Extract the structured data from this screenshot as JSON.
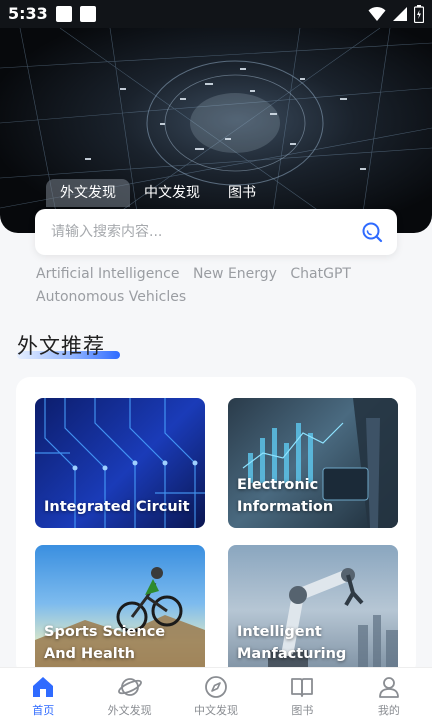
{
  "status_bar": {
    "time": "5:33"
  },
  "tabs": [
    {
      "label": "外文发现",
      "active": true
    },
    {
      "label": "中文发现",
      "active": false
    },
    {
      "label": "图书",
      "active": false
    }
  ],
  "search": {
    "placeholder": "请输入搜索内容..."
  },
  "hot_tags": [
    "Artificial Intelligence",
    "New Energy",
    "ChatGPT",
    "Autonomous Vehicles"
  ],
  "section": {
    "title": "外文推荐"
  },
  "cards": [
    {
      "label": "Integrated Circuit"
    },
    {
      "label": "Electronic Information"
    },
    {
      "label": "Sports Science And Health"
    },
    {
      "label": "Intelligent Manfacturing"
    }
  ],
  "nav": [
    {
      "label": "首页",
      "icon": "home-icon",
      "active": true
    },
    {
      "label": "外文发现",
      "icon": "planet-icon",
      "active": false
    },
    {
      "label": "中文发现",
      "icon": "compass-icon",
      "active": false
    },
    {
      "label": "图书",
      "icon": "book-icon",
      "active": false
    },
    {
      "label": "我的",
      "icon": "user-icon",
      "active": false
    }
  ],
  "colors": {
    "accent": "#2f6bff",
    "nav_inactive": "#8a8d92",
    "tag_text": "#9a9da2"
  }
}
